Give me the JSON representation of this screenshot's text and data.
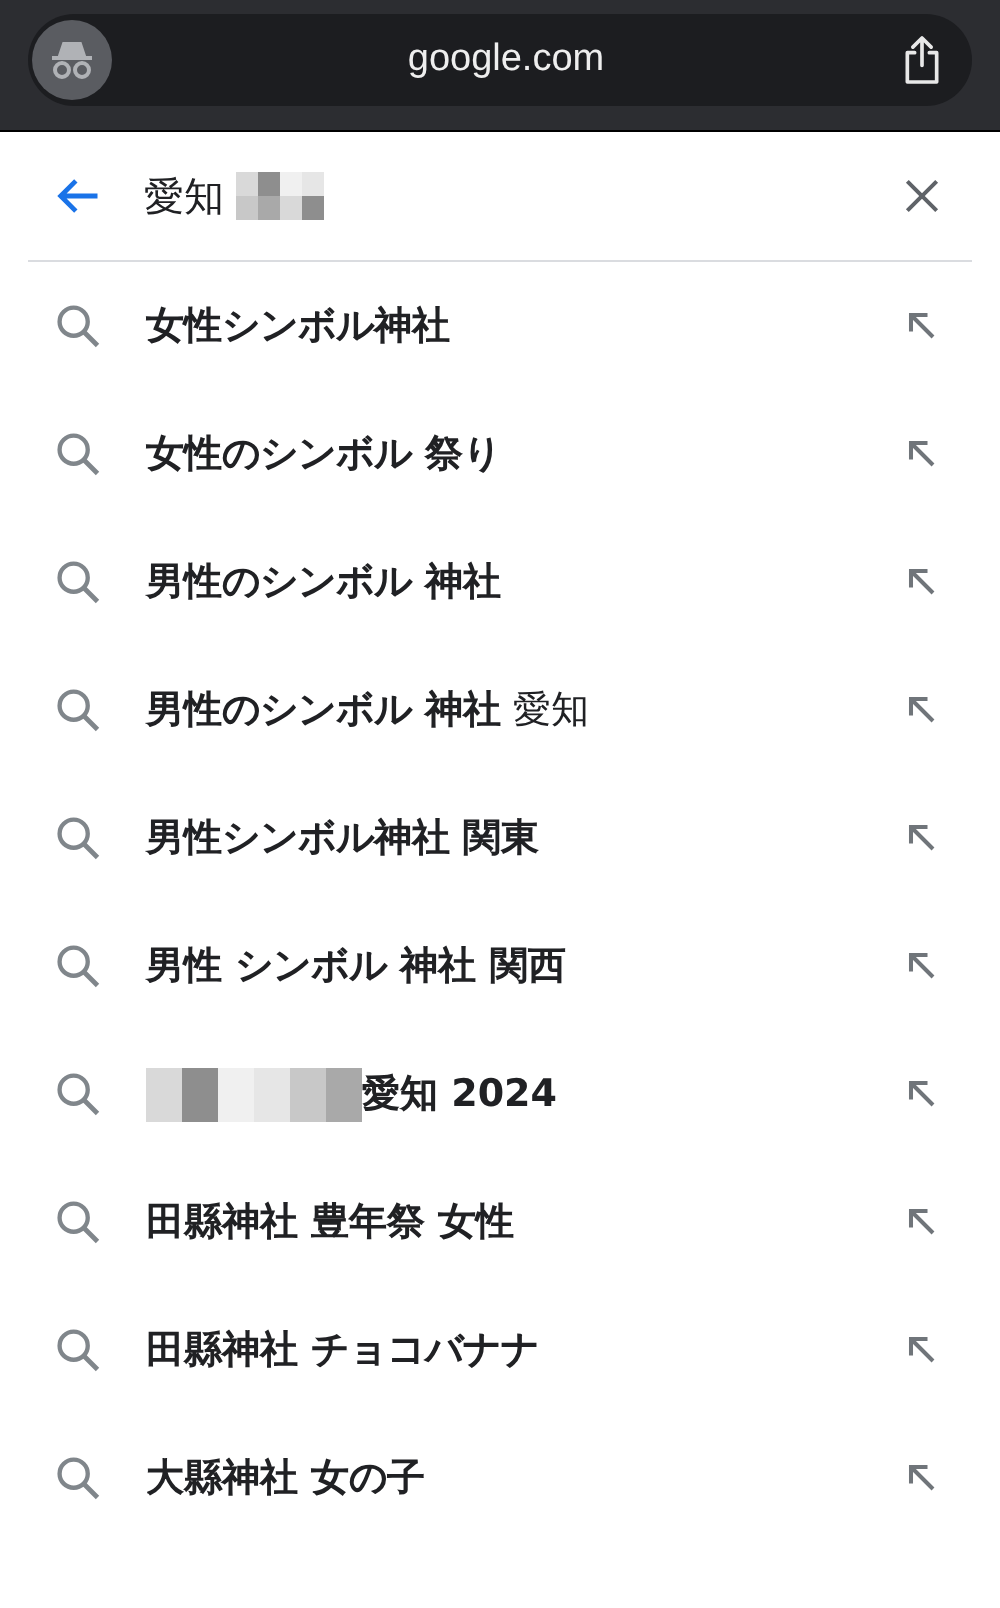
{
  "address_bar": {
    "url": "google.com"
  },
  "search": {
    "value": "愛知",
    "redacted": true
  },
  "suggestions": [
    {
      "text": "**女性シンボル神社**",
      "redacted": false
    },
    {
      "text": "**女性のシンボル 祭り**",
      "redacted": false
    },
    {
      "text": "**男性のシンボル 神社**",
      "redacted": false
    },
    {
      "text": "**男性のシンボル 神社** 愛知",
      "redacted": false
    },
    {
      "text": "**男性シンボル神社 関東**",
      "redacted": false
    },
    {
      "text": "**男性 シンボル 神社 関西**",
      "redacted": false
    },
    {
      "text": "**愛知 2024**",
      "redacted": true
    },
    {
      "text": "**田縣神社 豊年祭 女性**",
      "redacted": false
    },
    {
      "text": "**田縣神社 チョコバナナ**",
      "redacted": false
    },
    {
      "text": "**大縣神社 女の子**",
      "redacted": false
    }
  ]
}
